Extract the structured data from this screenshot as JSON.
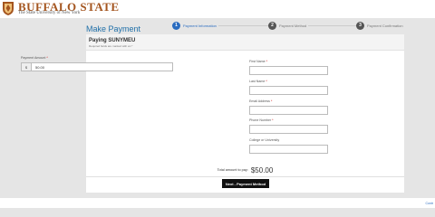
{
  "header": {
    "title": "BUFFALO STATE",
    "subtitle": "The State University of New York"
  },
  "page": {
    "title": "Make Payment"
  },
  "steps": [
    {
      "number": "1",
      "label": "Payment Information",
      "active": true
    },
    {
      "number": "2",
      "label": "Payment Method",
      "active": false
    },
    {
      "number": "3",
      "label": "Payment Confirmation",
      "active": false
    }
  ],
  "form": {
    "heading": "Paying SUNYMEU",
    "required_note": "Required fields are marked with an *",
    "required_marker": "*",
    "amount": {
      "label": "Payment Amount",
      "currency": "$",
      "value": "50.00"
    },
    "first_name": {
      "label": "First Name",
      "value": ""
    },
    "last_name": {
      "label": "Last Name",
      "value": ""
    },
    "email": {
      "label": "Email Address",
      "value": ""
    },
    "phone": {
      "label": "Phone Number",
      "value": ""
    },
    "college": {
      "label": "College or University",
      "value": ""
    }
  },
  "total": {
    "label": "Total amount to pay:",
    "value": "$50.00"
  },
  "next_button": {
    "label": "Next - Payment Method"
  },
  "footer": {
    "link": "Contr"
  },
  "colors": {
    "brand": "#a4551f",
    "accent": "#2a6cc0",
    "title": "#1f6fa8",
    "button": "#111111"
  }
}
